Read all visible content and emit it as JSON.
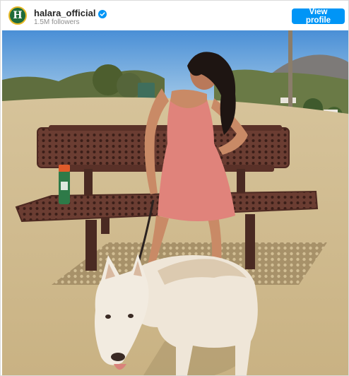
{
  "post_header": {
    "avatar_letter": "H",
    "username": "halara_official",
    "verified_icon": "verified-badge-icon",
    "followers": "1.5M followers",
    "view_profile_label": "View profile"
  },
  "colors": {
    "accent": "#0095f6",
    "avatar_bg": "#1f6b3a",
    "avatar_ring": "#e7b927"
  }
}
